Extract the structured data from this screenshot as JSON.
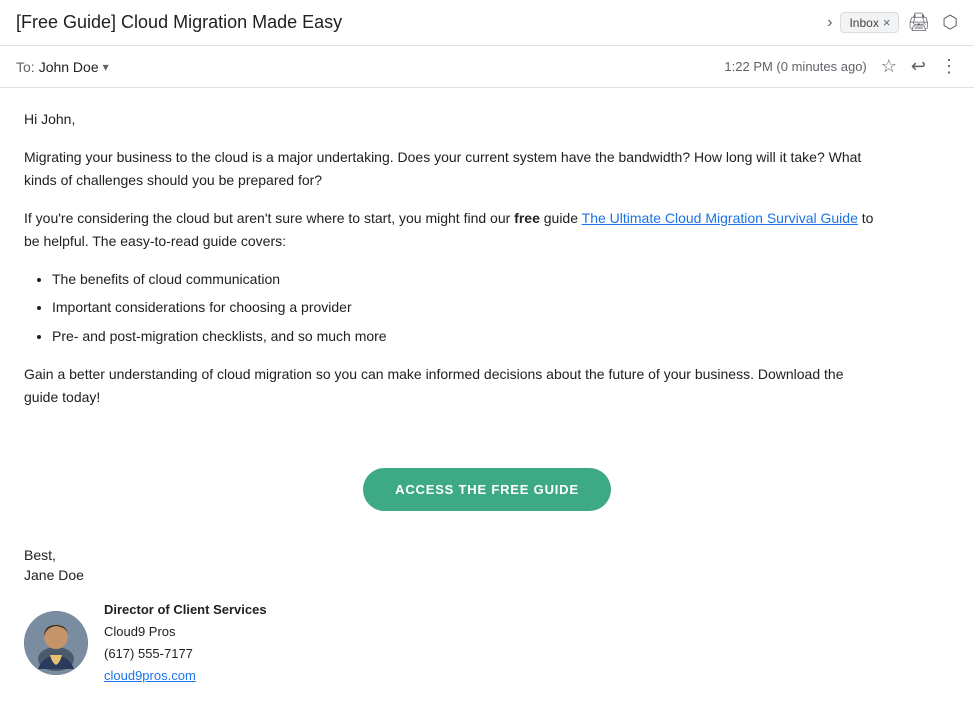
{
  "titleBar": {
    "subject": "[Free Guide] Cloud Migration Made Easy",
    "subjectIconLabel": "›",
    "inboxBadge": "Inbox",
    "inboxClose": "×",
    "printIcon": "🖨",
    "popoutIcon": "⤢"
  },
  "senderRow": {
    "toLabel": "To:",
    "recipientName": "John Doe",
    "chevron": "▾",
    "timestamp": "1:22 PM (0 minutes ago)",
    "starIcon": "☆",
    "replyIcon": "↩",
    "moreIcon": "⋮"
  },
  "emailBody": {
    "greeting": "Hi John,",
    "para1": "Migrating your business to the cloud is a major undertaking. Does your current system have the bandwidth? How long will it take? What kinds of challenges should you be prepared for?",
    "para2_before": "If you're considering the cloud but aren't sure where to start, you might find our ",
    "para2_bold": "free",
    "para2_middle": " guide ",
    "para2_link": "The Ultimate Cloud Migration Survival Guide",
    "para2_after": " to be helpful. The easy-to-read guide covers:",
    "bullets": [
      "The benefits of cloud communication",
      "Important considerations for choosing a provider",
      "Pre- and post-migration checklists, and so much more"
    ],
    "para3": "Gain a better understanding of cloud migration so you can make informed decisions about the future of your business. Download the guide today!",
    "ctaButton": "ACCESS THE FREE GUIDE",
    "closing": "Best,",
    "senderName": "Jane Doe",
    "sigTitle": "Director of Client Services",
    "sigCompany": "Cloud9 Pros",
    "sigPhone": "(617) 555-7177",
    "sigWebsite": "cloud9pros.com"
  }
}
